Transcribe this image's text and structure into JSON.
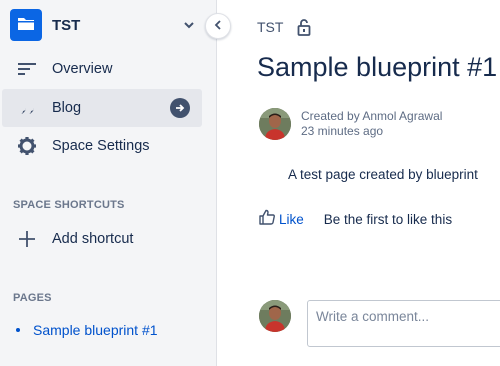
{
  "space": {
    "name": "TST"
  },
  "sidebar": {
    "items": [
      {
        "label": "Overview",
        "icon": "overview-lines-icon"
      },
      {
        "label": "Blog",
        "icon": "quote-icon",
        "active": true
      },
      {
        "label": "Space Settings",
        "icon": "gear-icon"
      }
    ],
    "shortcuts_heading": "SPACE SHORTCUTS",
    "add_shortcut_label": "Add shortcut",
    "pages_heading": "PAGES",
    "pages": [
      {
        "label": "Sample blueprint #1"
      }
    ]
  },
  "breadcrumb": {
    "space": "TST"
  },
  "page": {
    "title": "Sample blueprint #1",
    "byline": {
      "author": "Created by Anmol Agrawal",
      "time": "23 minutes ago"
    },
    "body": "A test page created by blueprint",
    "like": {
      "label": "Like",
      "message": "Be the first to like this"
    },
    "comment": {
      "placeholder": "Write a comment..."
    }
  },
  "colors": {
    "accent": "#0052cc",
    "logo": "#0b66e4",
    "sidebar_bg": "#f4f5f7"
  }
}
